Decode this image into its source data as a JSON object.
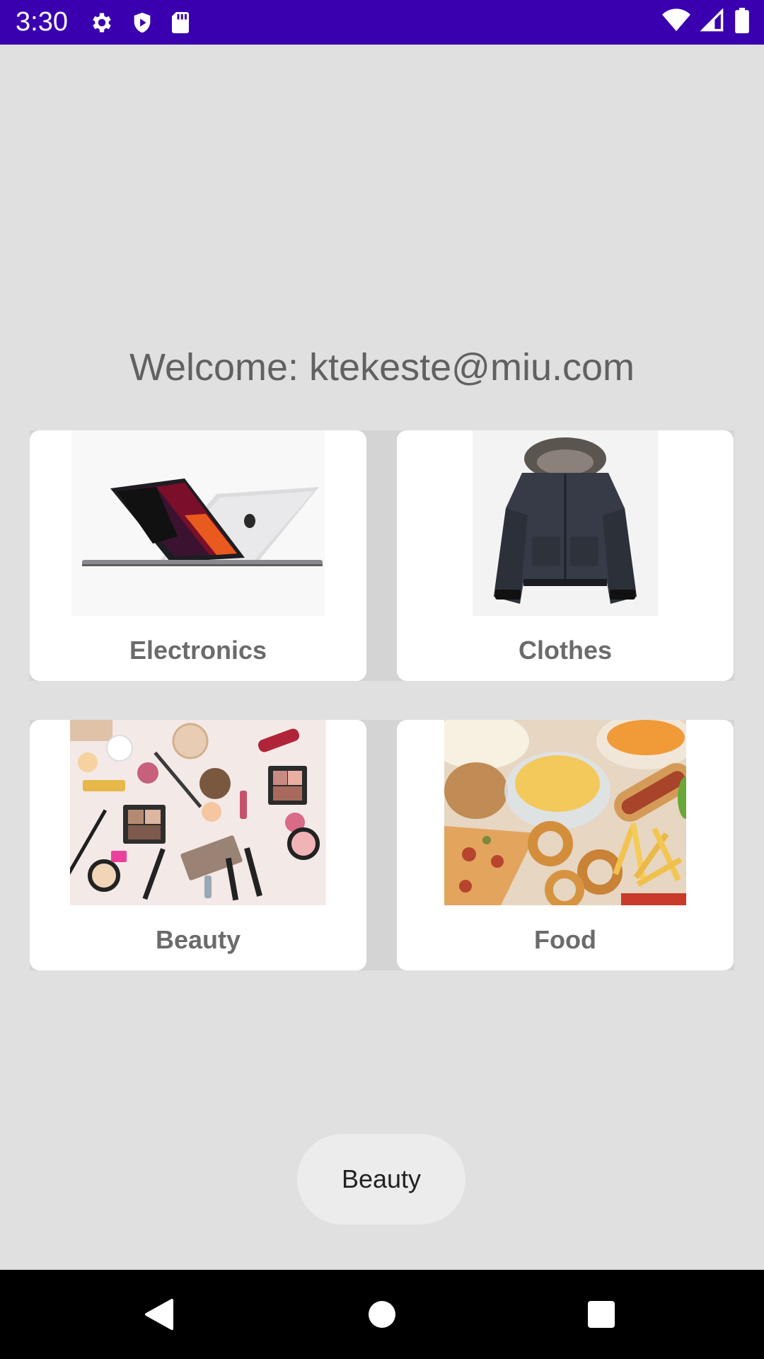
{
  "status_bar": {
    "time": "3:30",
    "left_icons": [
      "gear-icon",
      "shield-play-icon",
      "sd-card-icon"
    ],
    "right_icons": [
      "wifi-icon",
      "signal-icon",
      "battery-icon"
    ],
    "color": "#3a00b0"
  },
  "welcome": "Welcome: ktekeste@miu.com",
  "categories": [
    {
      "label": "Electronics",
      "image": "laptop-image"
    },
    {
      "label": "Clothes",
      "image": "jacket-image"
    },
    {
      "label": "Beauty",
      "image": "cosmetics-image"
    },
    {
      "label": "Food",
      "image": "snack-food-image"
    }
  ],
  "toast": "Beauty",
  "nav_bar": {
    "buttons": [
      "back-icon",
      "home-icon",
      "recents-icon"
    ]
  }
}
